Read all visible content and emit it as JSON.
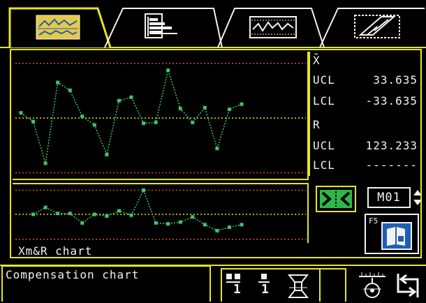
{
  "tabs": [
    {
      "name": "xmr-chart-tab",
      "icon": "control-chart-icon",
      "active": true
    },
    {
      "name": "histogram-tab",
      "icon": "histogram-icon",
      "active": false
    },
    {
      "name": "trend-tab",
      "icon": "trend-icon",
      "active": false
    },
    {
      "name": "probe-tab",
      "icon": "probe-icon",
      "active": false
    }
  ],
  "stats": {
    "xbar_symbol": "X̄",
    "xbar_ucl_label": "UCL",
    "xbar_ucl_value": "33.635",
    "xbar_lcl_label": "LCL",
    "xbar_lcl_value": "-33.635",
    "r_symbol": "R",
    "r_ucl_label": "UCL",
    "r_ucl_value": "123.233",
    "r_lcl_label": "LCL",
    "r_lcl_value": "-------"
  },
  "chart_caption": "Xm&R chart",
  "controls": {
    "select_value": "M01",
    "f5_label": "F5"
  },
  "status": {
    "text": "Compensation chart",
    "tool_counts": [
      "1",
      "1"
    ]
  },
  "colors": {
    "accent": "#e6e61a",
    "limit_line": "#d94a2a",
    "center_line": "#e6e61a",
    "data": "#3fc46a",
    "button_green": "#2db84a",
    "button_blue": "#1e5fb4"
  },
  "chart_data": [
    {
      "type": "line",
      "name": "",
      "x": [
        1,
        2,
        3,
        4,
        5,
        6,
        7,
        8,
        9,
        10,
        11,
        12,
        13,
        14,
        15,
        16,
        17,
        18,
        19
      ],
      "y": [
        0.6,
        -0.4,
        -5.2,
        4.1,
        3.2,
        0.2,
        -0.8,
        -4.2,
        2.0,
        2.4,
        -0.6,
        -0.5,
        5.5,
        1.1,
        -0.5,
        1.2,
        -3.5,
        1.0,
        1.6
      ],
      "ylim": [
        -6.5,
        7.0
      ],
      "limits": {
        "ucl": 6.3,
        "center": 0.0,
        "lcl": -6.3
      },
      "grid": false
    },
    {
      "type": "line",
      "name": "",
      "x": [
        2,
        3,
        4,
        5,
        6,
        7,
        8,
        9,
        10,
        11,
        12,
        13,
        14,
        15,
        16,
        17,
        18,
        19
      ],
      "y": [
        1.5,
        2.3,
        1.6,
        1.6,
        0.5,
        1.5,
        1.3,
        1.9,
        1.4,
        4.3,
        0.5,
        0.4,
        0.6,
        1.2,
        0.3,
        -0.4,
        0.0,
        0.3
      ],
      "ylim": [
        -1.5,
        4.5
      ],
      "limits": {
        "ucl": 4.3,
        "center": 1.5,
        "lcl": -1.4
      },
      "grid": false
    }
  ]
}
